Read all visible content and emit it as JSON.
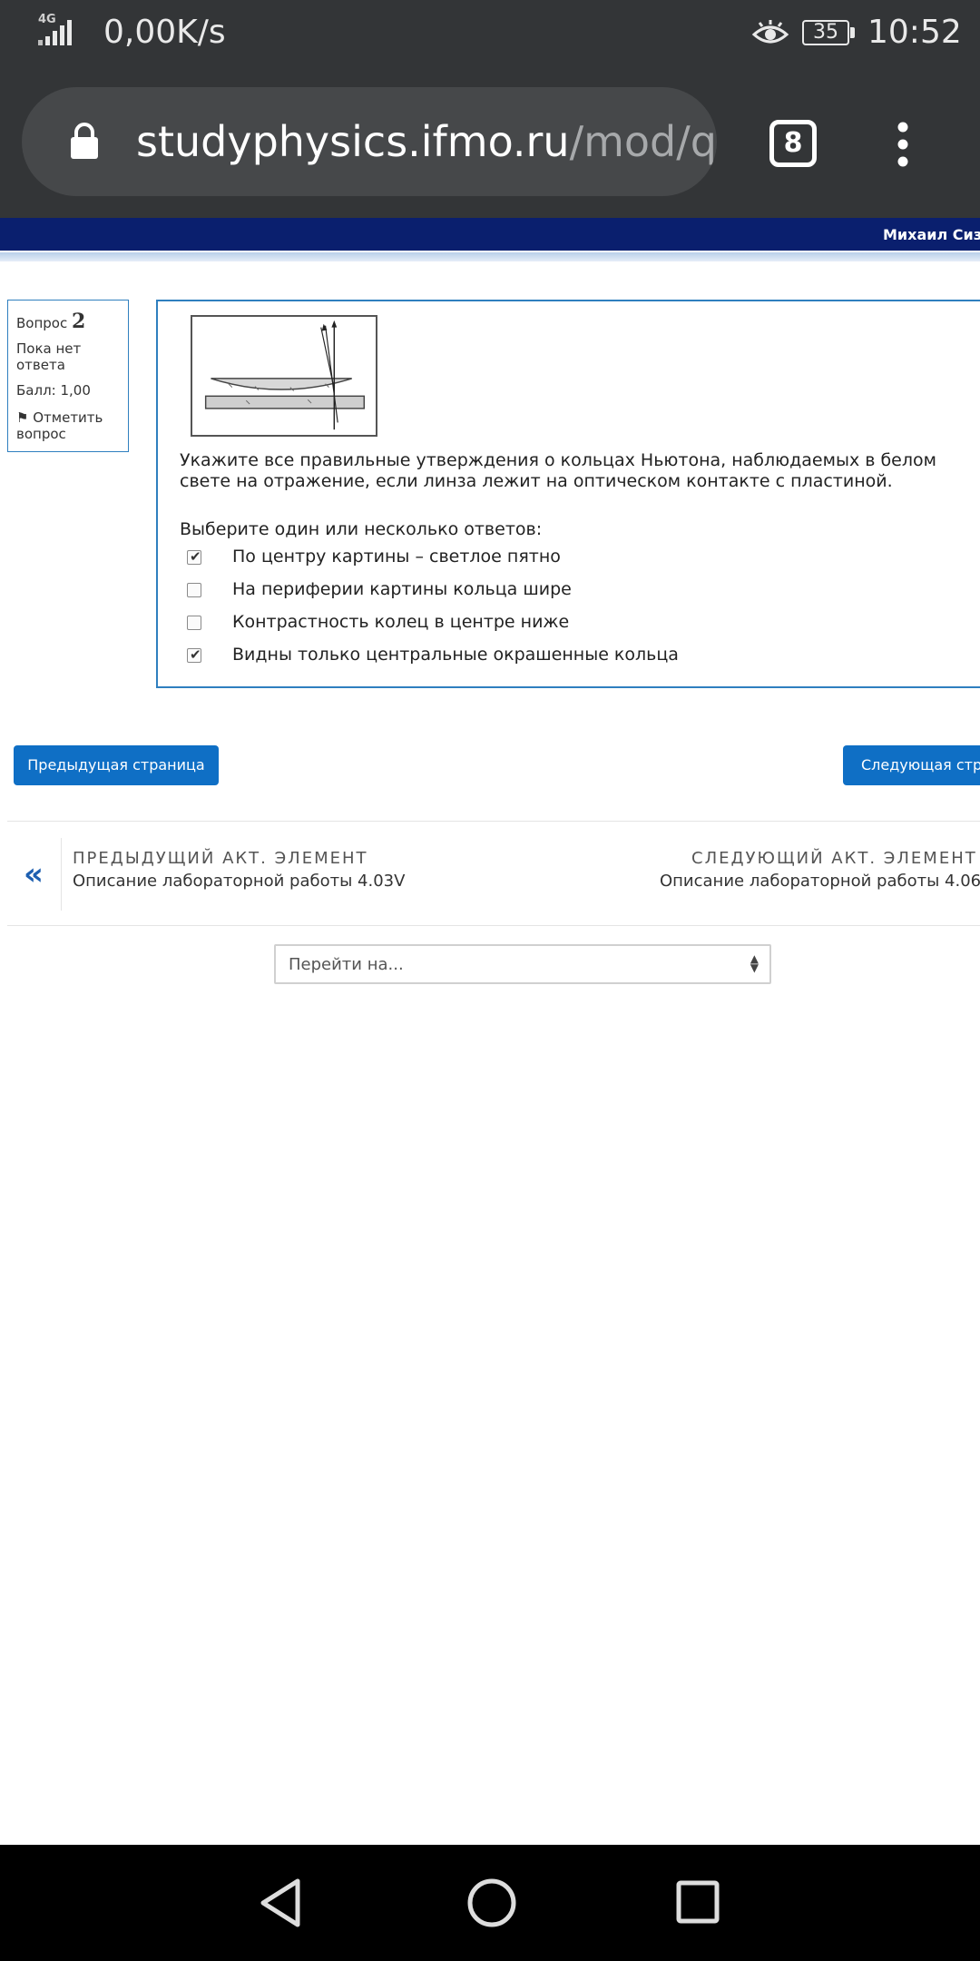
{
  "status_bar": {
    "network": "4G",
    "speed": "0,00K/s",
    "battery": "35",
    "time": "10:52"
  },
  "browser": {
    "url_host": "studyphysics.ifmo.ru",
    "url_path": "/mod/q",
    "tab_count": "8"
  },
  "site": {
    "user_name": "Михаил Сизо"
  },
  "question_info": {
    "label": "Вопрос",
    "number": "2",
    "state": "Пока нет ответа",
    "grade": "Балл: 1,00",
    "flag": "Отметить вопрос"
  },
  "question": {
    "text": "Укажите все правильные утверждения о кольцах Ньютона, наблюдаемых в белом свете на отражение, если линза лежит на оптическом контакте с пластиной.",
    "prompt": "Выберите один или несколько ответов:",
    "answers": [
      {
        "label": "По центру картины – светлое пятно",
        "checked": true
      },
      {
        "label": "На периферии картины кольца шире",
        "checked": false
      },
      {
        "label": "Контрастность колец в центре ниже",
        "checked": false
      },
      {
        "label": "Видны только центральные окрашенные кольца",
        "checked": true
      }
    ]
  },
  "navigation": {
    "prev_page": "Предыдущая страница",
    "next_page": "Следующая стра",
    "prev_activity_caption": "ПРЕДЫДУЩИЙ АКТ. ЭЛЕМЕНТ",
    "prev_activity_name": "Описание лабораторной работы 4.03V",
    "next_activity_caption": "СЛЕДУЮЩИЙ АКТ. ЭЛЕМЕНТ",
    "next_activity_name": "Описание лабораторной работы 4.06",
    "jump_placeholder": "Перейти на..."
  },
  "icons": {
    "back": "back-triangle-icon",
    "home": "home-circle-icon",
    "recent": "recent-square-icon"
  }
}
